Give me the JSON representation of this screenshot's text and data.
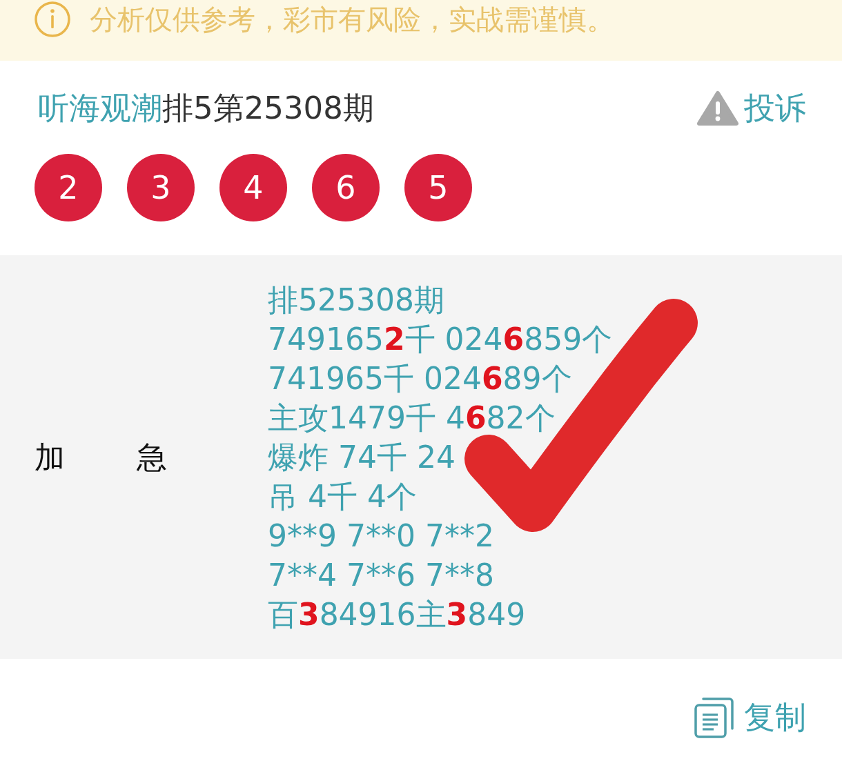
{
  "notice": {
    "text": "分析仅供参考，彩市有风险，实战需谨慎。"
  },
  "header": {
    "author": "听海观潮",
    "title": "排5第25308期",
    "complain_button": "投诉"
  },
  "balls": [
    "2",
    "3",
    "4",
    "6",
    "5"
  ],
  "post": {
    "label": "加 急",
    "lines": [
      [
        {
          "text": "排525308期",
          "highlight": false
        }
      ],
      [
        {
          "text": "749165",
          "highlight": false
        },
        {
          "text": "2",
          "highlight": true
        },
        {
          "text": "千 024",
          "highlight": false
        },
        {
          "text": "6",
          "highlight": true
        },
        {
          "text": "859个",
          "highlight": false
        }
      ],
      [
        {
          "text": "741965千 024",
          "highlight": false
        },
        {
          "text": "6",
          "highlight": true
        },
        {
          "text": "89个",
          "highlight": false
        }
      ],
      [
        {
          "text": "主攻1479千 4",
          "highlight": false
        },
        {
          "text": "6",
          "highlight": true
        },
        {
          "text": "82个",
          "highlight": false
        }
      ],
      [
        {
          "text": "爆炸 74千 24",
          "highlight": false
        }
      ],
      [
        {
          "text": "吊 4千 4个",
          "highlight": false
        }
      ],
      [
        {
          "text": "9**9 7**0 7**2",
          "highlight": false
        }
      ],
      [
        {
          "text": "7**4 7**6 7**8",
          "highlight": false
        }
      ],
      [
        {
          "text": "百",
          "highlight": false
        },
        {
          "text": "3",
          "highlight": true
        },
        {
          "text": "84916主",
          "highlight": false
        },
        {
          "text": "3",
          "highlight": true
        },
        {
          "text": "849",
          "highlight": false
        }
      ]
    ]
  },
  "copy_button": "复制"
}
